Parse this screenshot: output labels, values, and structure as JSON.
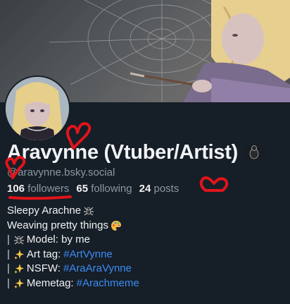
{
  "profile": {
    "display_name": "Aravynne (Vtuber/Artist)",
    "handle": "@aravynne.bsky.social",
    "stats": {
      "followers_count": "106",
      "followers_label": "followers",
      "following_count": "65",
      "following_label": "following",
      "posts_count": "24",
      "posts_label": "posts"
    },
    "bio": {
      "line1": "Sleepy Arachne",
      "line2": "Weaving pretty things",
      "line3": "Model: by me",
      "line4_label": "Art tag:",
      "line4_tag": "#ArtVynne",
      "line5_label": "NSFW:",
      "line5_tag": "#AraAraVynne",
      "line6_label": "Memetag:",
      "line6_tag": "#Arachmeme",
      "pipe": "|"
    }
  },
  "icons": [
    "spider-icon",
    "palette-icon",
    "sparkles-icon"
  ],
  "colors": {
    "background": "#161e27",
    "text": "#f1f3f5",
    "muted": "#8d98a5",
    "link": "#3b8df4",
    "annotation": "#e0141b"
  }
}
